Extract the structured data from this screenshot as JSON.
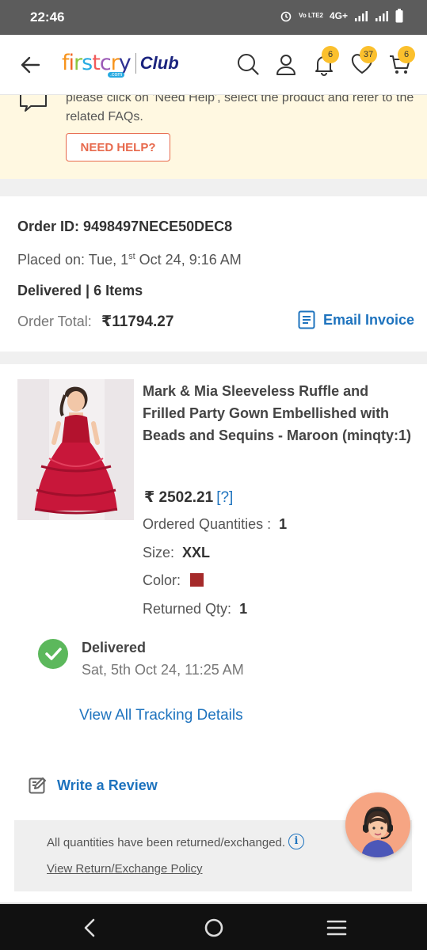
{
  "status_bar": {
    "time": "22:46",
    "network": "4G+",
    "volte": "Vo LTE2"
  },
  "header": {
    "brand_letters": [
      "f",
      "i",
      "r",
      "s",
      "t",
      "c",
      "r",
      "y"
    ],
    "brand_com": ".com",
    "brand_club": "Club",
    "notification_count": "6",
    "wishlist_count": "37",
    "cart_count": "6"
  },
  "help": {
    "text": "please click on 'Need Help', select the product and refer to the related FAQs.",
    "button_label": "NEED HELP?"
  },
  "order": {
    "order_id": "Order ID: 9498497NECE50DEC8",
    "placed_prefix": "Placed on: Tue, 1",
    "placed_sup": "st",
    "placed_suffix": " Oct 24, 9:16 AM",
    "delivered_items": "Delivered | 6 Items",
    "total_label": "Order Total:",
    "total_value": "₹11794.27",
    "email_invoice": "Email Invoice"
  },
  "product": {
    "title": "Mark & Mia Sleeveless Ruffle and Frilled Party Gown Embellished with Beads and Sequins - Maroon (minqty:1)",
    "price": "₹  2502.21",
    "price_help": "[?]",
    "ordered_label": "Ordered Quantities :",
    "ordered_value": "1",
    "size_label": "Size:",
    "size_value": "XXL",
    "color_label": "Color:",
    "color_hex": "#a52a2a",
    "returned_label": "Returned Qty:",
    "returned_value": "1"
  },
  "delivery": {
    "status": "Delivered",
    "date": "Sat, 5th Oct 24, 11:25 AM",
    "tracking_link": "View All Tracking Details"
  },
  "review": {
    "label": "Write a Review"
  },
  "returned_info": {
    "text": "All quantities have been returned/exchanged.",
    "info_glyph": "i",
    "policy_link": "View Return/Exchange Policy"
  }
}
